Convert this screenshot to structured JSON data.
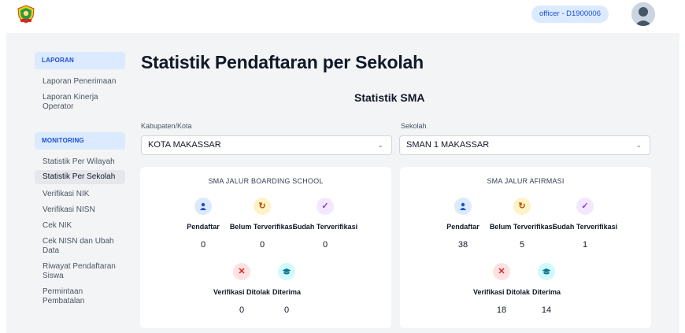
{
  "header": {
    "user_label": "officer - D1900006"
  },
  "sidebar": {
    "sections": [
      {
        "title": "LAPORAN",
        "items": [
          {
            "label": "Laporan Penerimaan",
            "active": false
          },
          {
            "label": "Laporan Kinerja Operator",
            "active": false
          }
        ]
      },
      {
        "title": "MONITORING",
        "items": [
          {
            "label": "Statistik Per Wilayah",
            "active": false
          },
          {
            "label": "Statistik Per Sekolah",
            "active": true
          },
          {
            "label": "Verifikasi NIK",
            "active": false
          },
          {
            "label": "Verifikasi NISN",
            "active": false
          },
          {
            "label": "Cek NIK",
            "active": false
          },
          {
            "label": "Cek NISN dan Ubah Data",
            "active": false
          },
          {
            "label": "Riwayat Pendaftaran Siswa",
            "active": false
          },
          {
            "label": "Permintaan Pembatalan",
            "active": false
          }
        ]
      }
    ]
  },
  "main": {
    "title": "Statistik Pendaftaran per Sekolah",
    "subtitle": "Statistik SMA",
    "filters": {
      "kabupaten": {
        "label": "Kabupaten/Kota",
        "value": "KOTA MAKASSAR"
      },
      "sekolah": {
        "label": "Sekolah",
        "value": "SMAN 1 MAKASSAR"
      }
    },
    "cards": [
      {
        "title": "SMA JALUR BOARDING SCHOOL",
        "stats": {
          "pendaftar": {
            "label": "Pendaftar",
            "value": "0"
          },
          "belum": {
            "label": "Belum Terverifikasi",
            "value": "0"
          },
          "sudah": {
            "label": "Sudah Terverifikasi",
            "value": "0"
          },
          "ditolak": {
            "label": "Verifikasi Ditolak",
            "value": "0"
          },
          "diterima": {
            "label": "Diterima",
            "value": "0"
          }
        }
      },
      {
        "title": "SMA JALUR AFIRMASI",
        "stats": {
          "pendaftar": {
            "label": "Pendaftar",
            "value": "38"
          },
          "belum": {
            "label": "Belum Terverifikasi",
            "value": "5"
          },
          "sudah": {
            "label": "Sudah Terverifikasi",
            "value": "1"
          },
          "ditolak": {
            "label": "Verifikasi Ditolak",
            "value": "18"
          },
          "diterima": {
            "label": "Diterima",
            "value": "14"
          }
        }
      }
    ]
  },
  "icons": {
    "pendaftar": "user-icon",
    "belum": "refresh-icon",
    "sudah": "check-icon",
    "ditolak": "close-icon",
    "diterima": "graduation-cap-icon"
  },
  "colors": {
    "accent": "#1d4ed8",
    "accent_light": "#dbeafe",
    "pending": "#b45309",
    "verified": "#9333ea",
    "rejected": "#dc2626",
    "accepted": "#0e7490"
  }
}
